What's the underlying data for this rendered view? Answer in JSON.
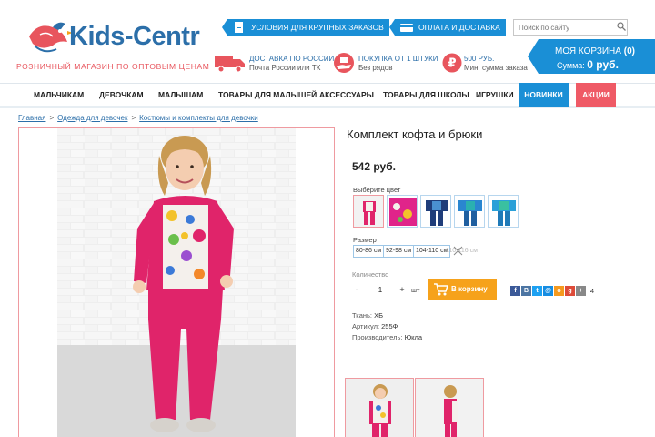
{
  "header": {
    "logo_title": "Kids-Centr",
    "logo_subtitle": "РОЗНИЧНЫЙ МАГАЗИН ПО ОПТОВЫМ ЦЕНАМ",
    "tags": [
      "УСЛОВИЯ ДЛЯ КРУПНЫХ ЗАКАЗОВ",
      "ОПЛАТА И ДОСТАВКА"
    ],
    "search": {
      "placeholder": "Поиск по сайту"
    },
    "info": [
      {
        "line1": "ДОСТАВКА ПО РОССИИ",
        "line2": "Почта России или ТК",
        "icon": "truck-icon"
      },
      {
        "line1": "ПОКУПКА ОТ 1 ШТУКИ",
        "line2": "Без рядов",
        "icon": "hand-box-icon"
      },
      {
        "line1": "500 РУБ.",
        "line2": "Мин. сумма заказа",
        "icon": "ruble-icon"
      }
    ],
    "cart": {
      "title": "МОЯ КОРЗИНА",
      "count": "(0)",
      "sum_label": "Сумма:",
      "sum_value": "0 руб."
    }
  },
  "nav": {
    "items": [
      "МАЛЬЧИКАМ",
      "ДЕВОЧКАМ",
      "МАЛЫШАМ",
      "ТОВАРЫ ДЛЯ МАЛЫШЕЙ",
      "АКСЕССУАРЫ",
      "ТОВАРЫ ДЛЯ ШКОЛЫ",
      "ИГРУШКИ"
    ],
    "new_label": "НОВИНКИ",
    "sale_label": "АКЦИИ"
  },
  "breadcrumb": [
    "Главная",
    "Одежда для девочек",
    "Костюмы и комплекты для девочки"
  ],
  "product": {
    "title": "Комплект кофта и брюки",
    "price": "542 руб.",
    "color_label": "Выберите цвет",
    "size_label": "Размер",
    "sizes": [
      "80-86 см",
      "92-98 см",
      "104-110 см",
      "110-116 см"
    ],
    "qty_label": "Количество",
    "qty_minus": "-",
    "qty_value": "1",
    "qty_plus": "+",
    "qty_unit": "шт",
    "buy_label": "В корзину",
    "social_count": "4",
    "specs": [
      {
        "label": "Ткань:",
        "value": "ХБ"
      },
      {
        "label": "Артикул:",
        "value": "255Ф"
      },
      {
        "label": "Производитель:",
        "value": "Юкла"
      }
    ]
  },
  "colors": {
    "brand_blue": "#1a8fd6",
    "accent_red": "#ef5a66",
    "buy_orange": "#f6a21b",
    "outfit_pink": "#e0246a"
  }
}
